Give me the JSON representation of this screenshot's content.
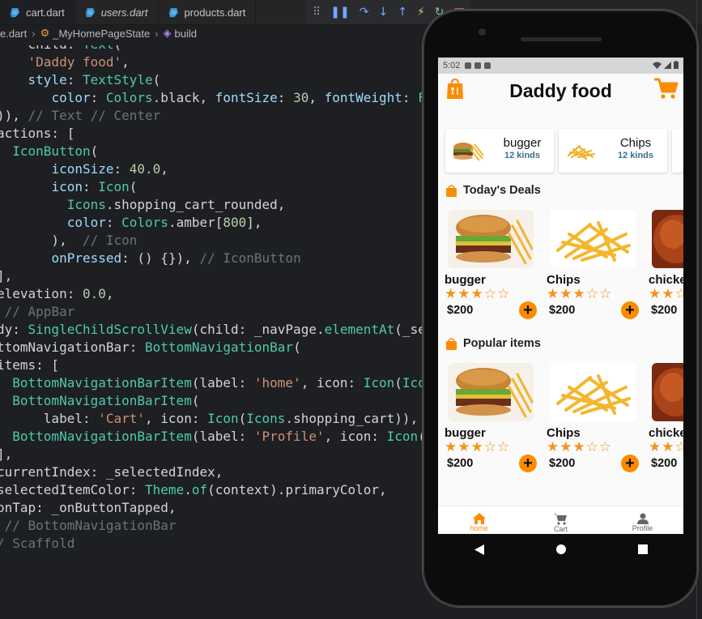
{
  "editor": {
    "tabs": [
      {
        "label": "cart.dart",
        "italic": false
      },
      {
        "label": "users.dart",
        "italic": true
      },
      {
        "label": "products.dart",
        "italic": false
      }
    ],
    "breadcrumb": {
      "file": "e.dart",
      "state": "_MyHomePageState",
      "method": "build"
    }
  },
  "phone": {
    "status_time": "5:02",
    "app_title": "Daddy food",
    "categories": [
      {
        "name": "bugger",
        "kinds": "12 kinds"
      },
      {
        "name": "Chips",
        "kinds": "12 kinds"
      }
    ],
    "sections": [
      {
        "title": "Today's Deals",
        "items": [
          {
            "name": "bugger",
            "price": "$200",
            "rating": 3,
            "max": 5
          },
          {
            "name": "Chips",
            "price": "$200",
            "rating": 3,
            "max": 5
          },
          {
            "name": "chicke",
            "price": "$200",
            "rating": 2,
            "max": 5
          }
        ]
      },
      {
        "title": "Popular items",
        "items": [
          {
            "name": "bugger",
            "price": "$200",
            "rating": 3,
            "max": 5
          },
          {
            "name": "Chips",
            "price": "$200",
            "rating": 3,
            "max": 5
          },
          {
            "name": "chicke",
            "price": "$200",
            "rating": 2,
            "max": 5
          }
        ]
      }
    ],
    "bottom_nav": [
      {
        "label": "home",
        "icon": "home-icon",
        "selected": true
      },
      {
        "label": "Cart",
        "icon": "cart-icon",
        "selected": false
      },
      {
        "label": "Profile",
        "icon": "person-icon",
        "selected": false
      }
    ],
    "accent": "#fb8c00"
  }
}
